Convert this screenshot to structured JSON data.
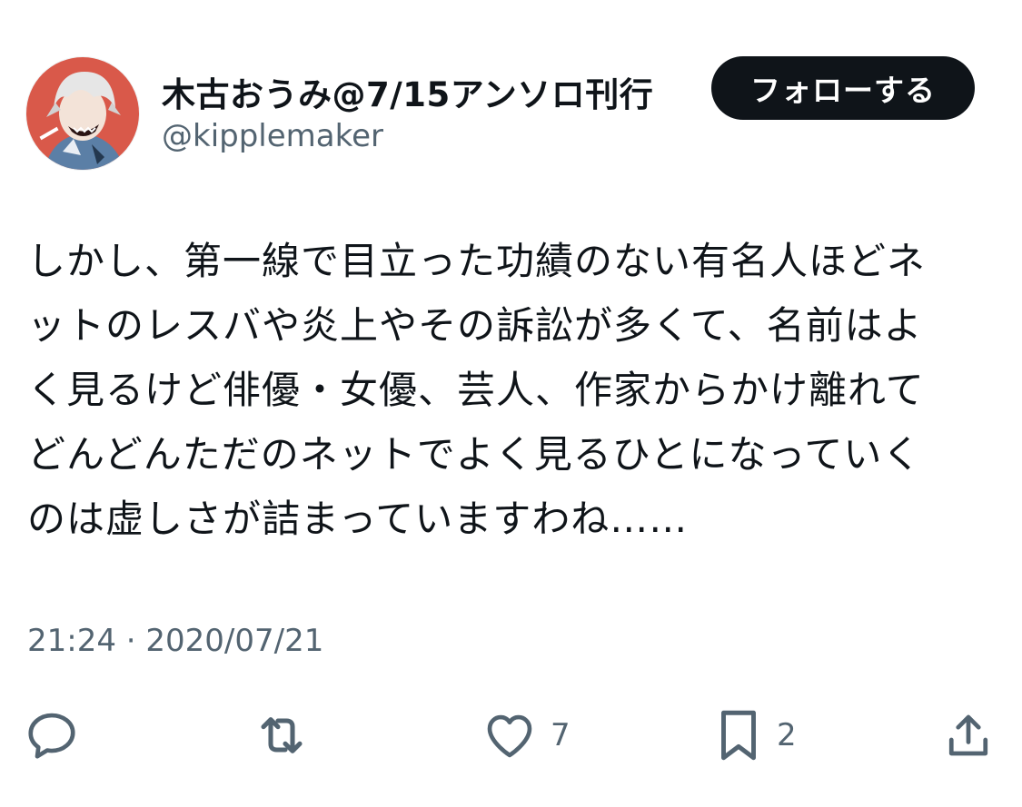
{
  "author": {
    "display_name": "木古おうみ@7/15アンソロ刊行",
    "handle": "@kipplemaker"
  },
  "follow_button_label": "フォローする",
  "tweet": {
    "text": "しかし、第一線で目立った功績のない有名人ほどネ\nットのレスバや炎上やその訴訟が多くて、名前はよ\nく見るけど俳優・女優、芸人、作家からかけ離れて\nどんどんただのネットでよく見るひとになっていく\nのは虚しさが詰まっていますわね……",
    "timestamp": "21:24 · 2020/07/21"
  },
  "actions": {
    "reply_icon": "reply-icon",
    "retweet_icon": "retweet-icon",
    "like_icon": "heart-icon",
    "like_count": "7",
    "bookmark_icon": "bookmark-icon",
    "bookmark_count": "2",
    "share_icon": "share-icon"
  },
  "colors": {
    "text_primary": "#0f1419",
    "text_secondary": "#536471",
    "follow_bg": "#0f1419",
    "avatar_bg": "#d9594a"
  }
}
